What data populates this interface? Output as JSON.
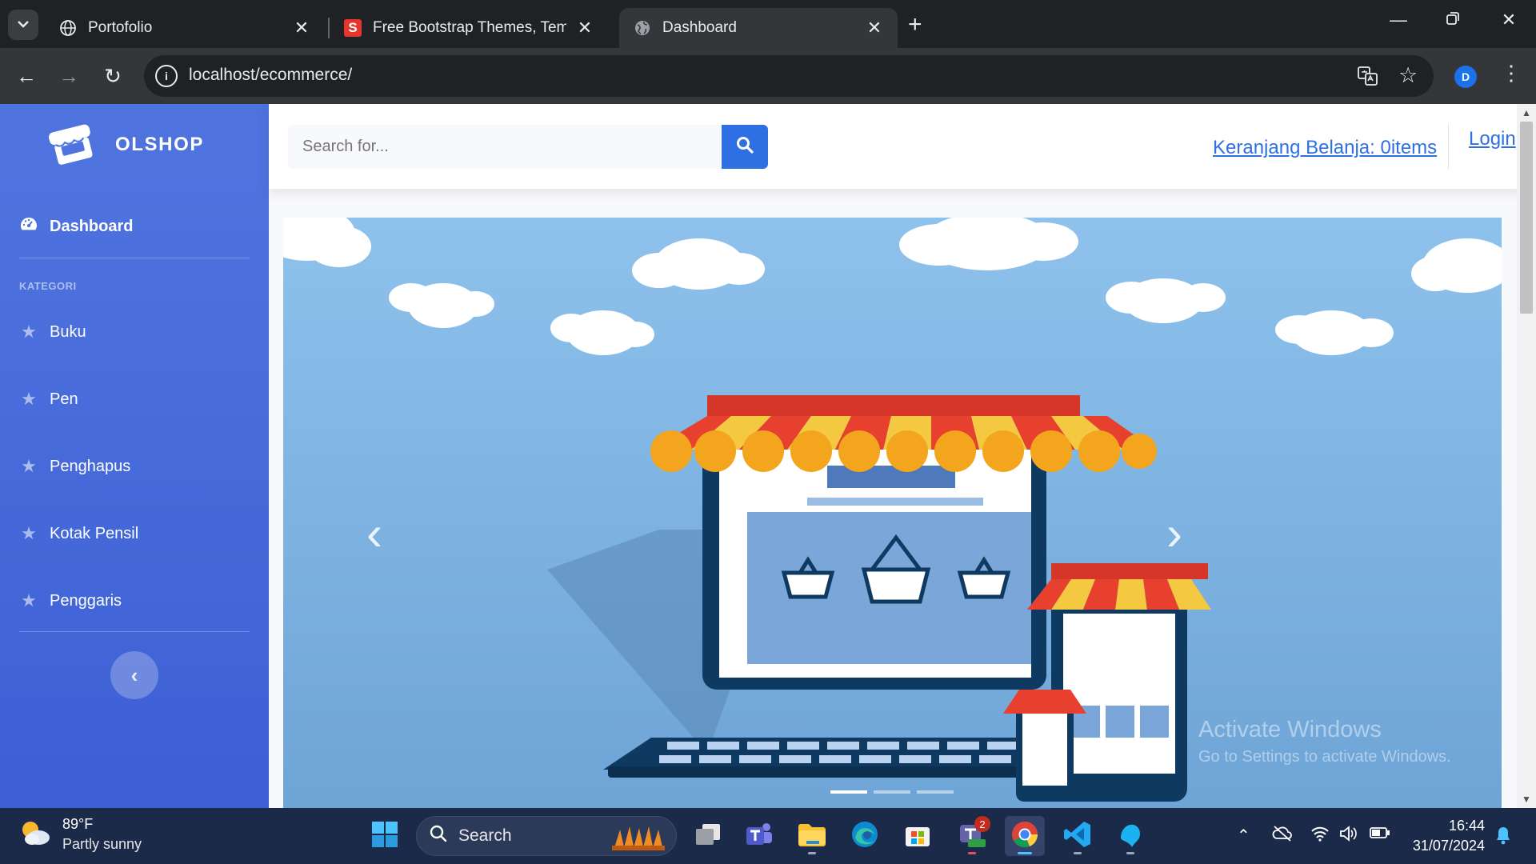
{
  "browser": {
    "tabs": [
      {
        "title": "Portofolio",
        "active": false,
        "favicon": "globe-icon"
      },
      {
        "title": "Free Bootstrap Themes, Templa",
        "active": false,
        "favicon": "s-logo-icon"
      },
      {
        "title": "Dashboard",
        "active": true,
        "favicon": "globe-icon"
      }
    ],
    "url": "localhost/ecommerce/",
    "profile_initial": "D"
  },
  "sidebar": {
    "brand": "OLSHOP",
    "dashboard_label": "Dashboard",
    "heading": "KATEGORI",
    "categories": [
      {
        "label": "Buku",
        "icon": "star-icon"
      },
      {
        "label": "Pen",
        "icon": "star-icon"
      },
      {
        "label": "Penghapus",
        "icon": "star-icon"
      },
      {
        "label": "Kotak Pensil",
        "icon": "star-icon"
      },
      {
        "label": "Penggaris",
        "icon": "star-icon"
      }
    ]
  },
  "topbar": {
    "search_placeholder": "Search for...",
    "cart_label": "Keranjang Belanja: 0items",
    "login_label": "Login"
  },
  "carousel": {
    "slide_count": 3,
    "active_index": 0
  },
  "watermark": {
    "title": "Activate Windows",
    "subtitle": "Go to Settings to activate Windows."
  },
  "taskbar": {
    "weather_temp": "89°F",
    "weather_desc": "Partly sunny",
    "search_label": "Search",
    "teams_badge": "2",
    "time": "16:44",
    "date": "31/07/2024"
  },
  "colors": {
    "sidebar": "#4e73df",
    "primary": "#2f6fe4",
    "sky": "#7fb2e1"
  }
}
